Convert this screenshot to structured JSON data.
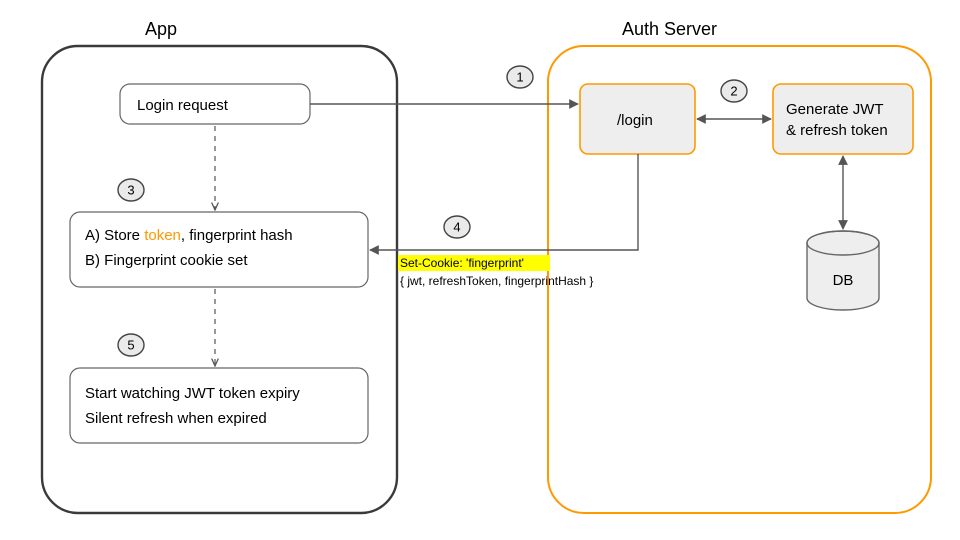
{
  "app": {
    "title": "App",
    "nodes": {
      "login_request": "Login request",
      "store": {
        "lineA_pre": "A) Store ",
        "lineA_token": "token",
        "lineA_post": ", fingerprint hash",
        "lineB": "B) Fingerprint cookie set"
      },
      "watch": {
        "line1": "Start watching JWT token expiry",
        "line2": "Silent refresh when expired"
      }
    }
  },
  "auth": {
    "title": "Auth Server",
    "nodes": {
      "login_endpoint": "/login",
      "generate": {
        "line1": "Generate JWT",
        "line2": "& refresh token"
      },
      "db": "DB"
    }
  },
  "arrows": {
    "set_cookie": "Set-Cookie: 'fingerprint'",
    "payload": "{ jwt, refreshToken, fingerprintHash }"
  },
  "steps": {
    "s1": "1",
    "s2": "2",
    "s3": "3",
    "s4": "4",
    "s5": "5"
  },
  "colors": {
    "orange": "#ff9900",
    "highlight": "#ffff00",
    "frame_gray": "#3a3a3a"
  }
}
